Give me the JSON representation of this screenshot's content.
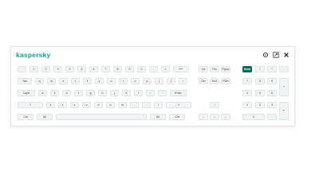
{
  "app": {
    "brand": "kaspersky",
    "accent": "#006d5b",
    "brand_color": "#15a28e"
  },
  "window_controls": {
    "settings_icon": "gear-icon",
    "resize_icon": "resize-icon",
    "close_icon": "close-icon"
  },
  "main_rows": [
    [
      "`",
      "1",
      "2",
      "3",
      "4",
      "5",
      "6",
      "7",
      "8",
      "9",
      "0",
      "-",
      "=",
      "⟵"
    ],
    [
      "Tab",
      "q",
      "w",
      "e",
      "r",
      "t",
      "y",
      "u",
      "i",
      "o",
      "p",
      "[",
      "]",
      "\\"
    ],
    [
      "Caps",
      "a",
      "s",
      "d",
      "f",
      "g",
      "h",
      "j",
      "k",
      "l",
      ";",
      "'",
      "Enter"
    ],
    [
      "⇧",
      "z",
      "x",
      "c",
      "v",
      "b",
      "n",
      "m",
      ",",
      ".",
      "/",
      "⇧"
    ],
    [
      "Ctrl",
      "Alt",
      "",
      "Alt",
      "Ctrl"
    ]
  ],
  "nav_keys": {
    "row1": [
      "Ins",
      "Hm",
      "PgUp"
    ],
    "row2": [
      "Del",
      "End",
      "PDn"
    ],
    "arrows": [
      "↑",
      "←",
      "↓",
      "→"
    ]
  },
  "numpad": {
    "row1": [
      "Num",
      "/",
      "*",
      "-"
    ],
    "row2": [
      "7",
      "8",
      "9",
      "+"
    ],
    "row3": [
      "4",
      "5",
      "6"
    ],
    "row4": [
      "1",
      "2",
      "3",
      "↵"
    ],
    "row5": [
      "0",
      "."
    ]
  }
}
